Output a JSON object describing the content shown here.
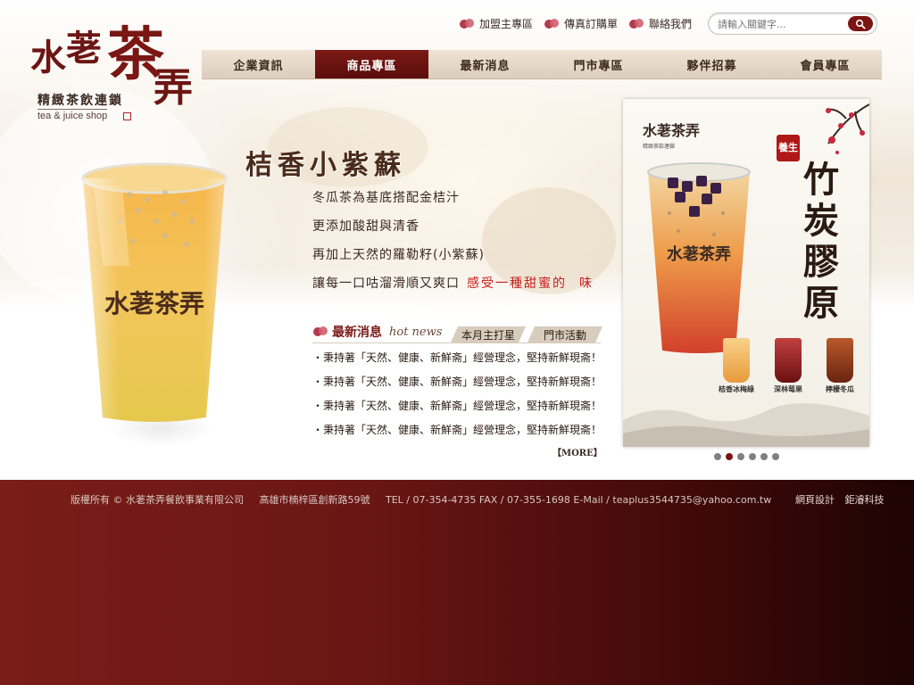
{
  "brand": {
    "logo_chars": [
      "水",
      "荖",
      "茶",
      "弄"
    ],
    "subtitle": "精緻茶飲連鎖",
    "tagline": "tea & juice shop"
  },
  "top_links": [
    {
      "label": "加盟主專區",
      "icon": "flower-icon"
    },
    {
      "label": "傳真訂購單",
      "icon": "flower-icon"
    },
    {
      "label": "聯絡我們",
      "icon": "flower-icon"
    }
  ],
  "search": {
    "placeholder": "請輸入關鍵字...",
    "icon": "search-icon"
  },
  "nav": {
    "items": [
      "企業資訊",
      "商品專區",
      "最新消息",
      "門市專區",
      "夥伴招募",
      "會員專區"
    ],
    "active_index": 1
  },
  "promo": {
    "title": "桔香小紫蘇",
    "lines": [
      "冬瓜茶為基底搭配金桔汁",
      "更添加酸甜與清香",
      "再加上天然的羅勒籽(小紫蘇)",
      "讓每一口咕溜滑順又爽口"
    ],
    "highlight": "感受一種甜蜜的",
    "highlight_tail": "味",
    "cup_logo": "水荖茶弄"
  },
  "news": {
    "title": "最新消息",
    "title_en": "hot news",
    "tabs": [
      "本月主打星",
      "門市活動"
    ],
    "items": [
      "・秉持著「天然、健康、新鮮斋」經營理念，堅持新鮮現斋！",
      "・秉持著「天然、健康、新鮮斋」經營理念，堅持新鮮現斋！",
      "・秉持著「天然、健康、新鮮斋」經營理念，堅持新鮮現斋！",
      "・秉持著「天然、健康、新鮮斋」經營理念，堅持新鮮現斋！"
    ],
    "more": "【MORE】"
  },
  "poster": {
    "logo": "水荖茶弄",
    "logo_sub": "精緻茶飲連鎖",
    "badge": "養生",
    "title": "竹炭膠原",
    "minis": [
      {
        "name": "桔香冰梅綠",
        "color": "#e89a3a"
      },
      {
        "name": "深林莓果",
        "color": "#a8201c"
      },
      {
        "name": "檸檬冬瓜",
        "color": "#8a3318"
      }
    ],
    "slide_count": 6,
    "active_slide": 1
  },
  "footer": {
    "copyright": "版權所有 © 水荖茶弄餐飲事業有限公司",
    "address": "高雄市楠梓區創新路59號",
    "contact": "TEL / 07-354-4735  FAX / 07-355-1698  E-Mail / teaplus3544735@yahoo.com.tw",
    "credit_label": "網頁設計",
    "credit_name": "鉅濬科技"
  }
}
